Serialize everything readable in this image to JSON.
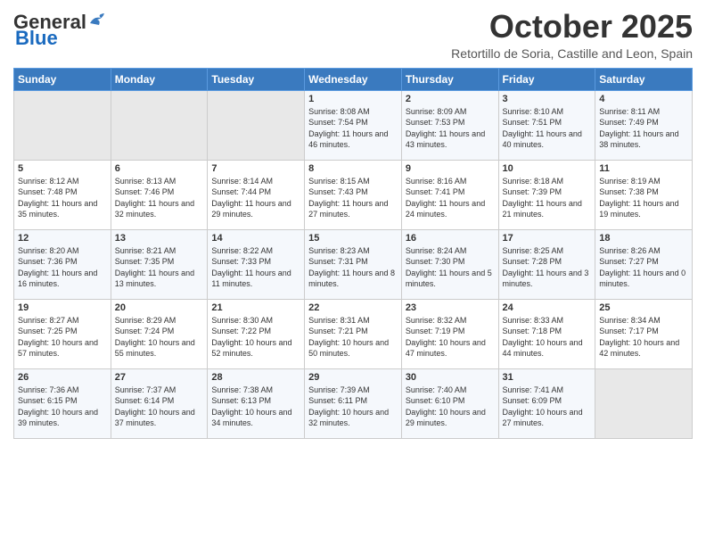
{
  "header": {
    "logo_general": "General",
    "logo_blue": "Blue",
    "month_title": "October 2025",
    "subtitle": "Retortillo de Soria, Castille and Leon, Spain"
  },
  "weekdays": [
    "Sunday",
    "Monday",
    "Tuesday",
    "Wednesday",
    "Thursday",
    "Friday",
    "Saturday"
  ],
  "weeks": [
    [
      {
        "day": "",
        "sunrise": "",
        "sunset": "",
        "daylight": ""
      },
      {
        "day": "",
        "sunrise": "",
        "sunset": "",
        "daylight": ""
      },
      {
        "day": "",
        "sunrise": "",
        "sunset": "",
        "daylight": ""
      },
      {
        "day": "1",
        "sunrise": "Sunrise: 8:08 AM",
        "sunset": "Sunset: 7:54 PM",
        "daylight": "Daylight: 11 hours and 46 minutes."
      },
      {
        "day": "2",
        "sunrise": "Sunrise: 8:09 AM",
        "sunset": "Sunset: 7:53 PM",
        "daylight": "Daylight: 11 hours and 43 minutes."
      },
      {
        "day": "3",
        "sunrise": "Sunrise: 8:10 AM",
        "sunset": "Sunset: 7:51 PM",
        "daylight": "Daylight: 11 hours and 40 minutes."
      },
      {
        "day": "4",
        "sunrise": "Sunrise: 8:11 AM",
        "sunset": "Sunset: 7:49 PM",
        "daylight": "Daylight: 11 hours and 38 minutes."
      }
    ],
    [
      {
        "day": "5",
        "sunrise": "Sunrise: 8:12 AM",
        "sunset": "Sunset: 7:48 PM",
        "daylight": "Daylight: 11 hours and 35 minutes."
      },
      {
        "day": "6",
        "sunrise": "Sunrise: 8:13 AM",
        "sunset": "Sunset: 7:46 PM",
        "daylight": "Daylight: 11 hours and 32 minutes."
      },
      {
        "day": "7",
        "sunrise": "Sunrise: 8:14 AM",
        "sunset": "Sunset: 7:44 PM",
        "daylight": "Daylight: 11 hours and 29 minutes."
      },
      {
        "day": "8",
        "sunrise": "Sunrise: 8:15 AM",
        "sunset": "Sunset: 7:43 PM",
        "daylight": "Daylight: 11 hours and 27 minutes."
      },
      {
        "day": "9",
        "sunrise": "Sunrise: 8:16 AM",
        "sunset": "Sunset: 7:41 PM",
        "daylight": "Daylight: 11 hours and 24 minutes."
      },
      {
        "day": "10",
        "sunrise": "Sunrise: 8:18 AM",
        "sunset": "Sunset: 7:39 PM",
        "daylight": "Daylight: 11 hours and 21 minutes."
      },
      {
        "day": "11",
        "sunrise": "Sunrise: 8:19 AM",
        "sunset": "Sunset: 7:38 PM",
        "daylight": "Daylight: 11 hours and 19 minutes."
      }
    ],
    [
      {
        "day": "12",
        "sunrise": "Sunrise: 8:20 AM",
        "sunset": "Sunset: 7:36 PM",
        "daylight": "Daylight: 11 hours and 16 minutes."
      },
      {
        "day": "13",
        "sunrise": "Sunrise: 8:21 AM",
        "sunset": "Sunset: 7:35 PM",
        "daylight": "Daylight: 11 hours and 13 minutes."
      },
      {
        "day": "14",
        "sunrise": "Sunrise: 8:22 AM",
        "sunset": "Sunset: 7:33 PM",
        "daylight": "Daylight: 11 hours and 11 minutes."
      },
      {
        "day": "15",
        "sunrise": "Sunrise: 8:23 AM",
        "sunset": "Sunset: 7:31 PM",
        "daylight": "Daylight: 11 hours and 8 minutes."
      },
      {
        "day": "16",
        "sunrise": "Sunrise: 8:24 AM",
        "sunset": "Sunset: 7:30 PM",
        "daylight": "Daylight: 11 hours and 5 minutes."
      },
      {
        "day": "17",
        "sunrise": "Sunrise: 8:25 AM",
        "sunset": "Sunset: 7:28 PM",
        "daylight": "Daylight: 11 hours and 3 minutes."
      },
      {
        "day": "18",
        "sunrise": "Sunrise: 8:26 AM",
        "sunset": "Sunset: 7:27 PM",
        "daylight": "Daylight: 11 hours and 0 minutes."
      }
    ],
    [
      {
        "day": "19",
        "sunrise": "Sunrise: 8:27 AM",
        "sunset": "Sunset: 7:25 PM",
        "daylight": "Daylight: 10 hours and 57 minutes."
      },
      {
        "day": "20",
        "sunrise": "Sunrise: 8:29 AM",
        "sunset": "Sunset: 7:24 PM",
        "daylight": "Daylight: 10 hours and 55 minutes."
      },
      {
        "day": "21",
        "sunrise": "Sunrise: 8:30 AM",
        "sunset": "Sunset: 7:22 PM",
        "daylight": "Daylight: 10 hours and 52 minutes."
      },
      {
        "day": "22",
        "sunrise": "Sunrise: 8:31 AM",
        "sunset": "Sunset: 7:21 PM",
        "daylight": "Daylight: 10 hours and 50 minutes."
      },
      {
        "day": "23",
        "sunrise": "Sunrise: 8:32 AM",
        "sunset": "Sunset: 7:19 PM",
        "daylight": "Daylight: 10 hours and 47 minutes."
      },
      {
        "day": "24",
        "sunrise": "Sunrise: 8:33 AM",
        "sunset": "Sunset: 7:18 PM",
        "daylight": "Daylight: 10 hours and 44 minutes."
      },
      {
        "day": "25",
        "sunrise": "Sunrise: 8:34 AM",
        "sunset": "Sunset: 7:17 PM",
        "daylight": "Daylight: 10 hours and 42 minutes."
      }
    ],
    [
      {
        "day": "26",
        "sunrise": "Sunrise: 7:36 AM",
        "sunset": "Sunset: 6:15 PM",
        "daylight": "Daylight: 10 hours and 39 minutes."
      },
      {
        "day": "27",
        "sunrise": "Sunrise: 7:37 AM",
        "sunset": "Sunset: 6:14 PM",
        "daylight": "Daylight: 10 hours and 37 minutes."
      },
      {
        "day": "28",
        "sunrise": "Sunrise: 7:38 AM",
        "sunset": "Sunset: 6:13 PM",
        "daylight": "Daylight: 10 hours and 34 minutes."
      },
      {
        "day": "29",
        "sunrise": "Sunrise: 7:39 AM",
        "sunset": "Sunset: 6:11 PM",
        "daylight": "Daylight: 10 hours and 32 minutes."
      },
      {
        "day": "30",
        "sunrise": "Sunrise: 7:40 AM",
        "sunset": "Sunset: 6:10 PM",
        "daylight": "Daylight: 10 hours and 29 minutes."
      },
      {
        "day": "31",
        "sunrise": "Sunrise: 7:41 AM",
        "sunset": "Sunset: 6:09 PM",
        "daylight": "Daylight: 10 hours and 27 minutes."
      },
      {
        "day": "",
        "sunrise": "",
        "sunset": "",
        "daylight": ""
      }
    ]
  ]
}
